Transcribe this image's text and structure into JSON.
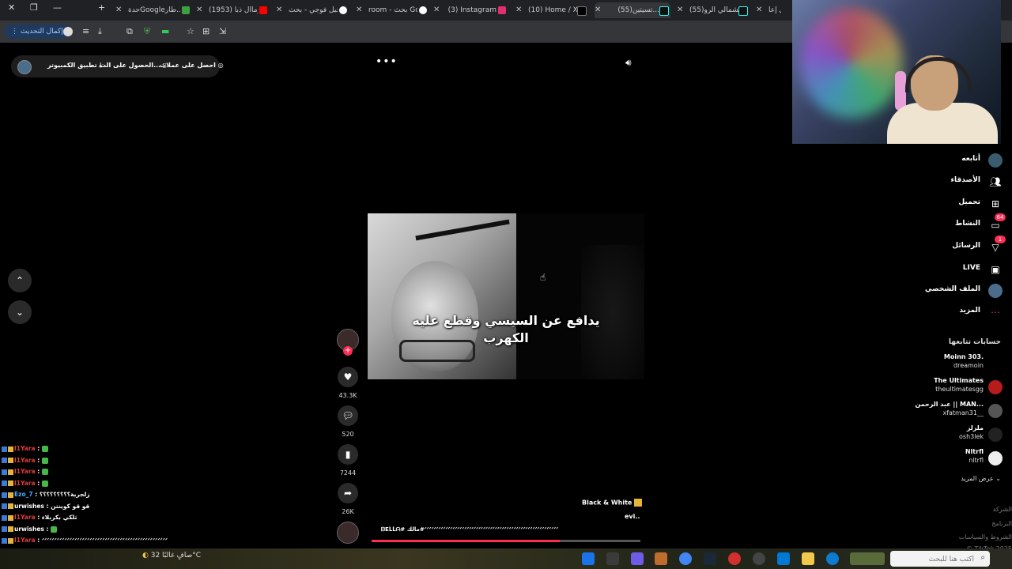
{
  "browser": {
    "tabs": [
      {
        "label": "حدةGoogleطار..."
      },
      {
        "label": "(1953) روماال ذبا..."
      },
      {
        "label": "جبل فوجي - بحث"
      },
      {
        "label": "room - بحث Goo"
      },
      {
        "label": "(3) Instagram"
      },
      {
        "label": "(10) Home / X"
      },
      {
        "label": "(55)تسيتين..."
      },
      {
        "label": "(55)الشمالي الرو..."
      },
      {
        "label": "ماصل إعا..."
      }
    ],
    "update_button": "إكمال التحديث"
  },
  "tiktok": {
    "top_bar": {
      "get_coins": "احصل على عملات",
      "get_app": "الحصول على الت...",
      "desktop_app": "تطبيق الكمبيوتر"
    },
    "video": {
      "caption_line1": "يدافع عن السيسي وقطع عليه",
      "caption_line2": "الكهرب",
      "music_label": "Black & White",
      "description": "evi..",
      "hashtags": "ᗷEᒪᒪᗩ# ﻣﺎﻟﻚ#ᐟᐟᐟᐟᐟᐟᐟᐟᐟᐟᐟᐟᐟᐟᐟᐟᐟᐟᐟᐟᐟᐟᐟᐟᐟᐟᐟᐟᐟᐟᐟᐟᐟᐟᐟᐟᐟᐟᐟᐟᐟᐟᐟᐟᐟᐟᐟᐟᐟᐟᐟᐟᐟᐟᐟᐟᐟ",
      "progress": 0.7
    },
    "actions": {
      "likes": "43.3K",
      "comments": "520",
      "saves": "7244",
      "shares": "26K"
    },
    "sidebar": {
      "items": [
        {
          "label": "أتابعه",
          "icon": "following-icon"
        },
        {
          "label": "الأصدقاء",
          "icon": "friends-icon"
        },
        {
          "label": "تحميل",
          "icon": "upload-icon"
        },
        {
          "label": "النشاط",
          "icon": "activity-icon",
          "badge": "64"
        },
        {
          "label": "الرسائل",
          "icon": "messages-icon",
          "badge": "1"
        },
        {
          "label": "LIVE",
          "icon": "live-icon"
        },
        {
          "label": "الملف الشخصي",
          "icon": "profile-icon"
        },
        {
          "label": "المزيد",
          "icon": "more-icon"
        }
      ],
      "following_title": "حسابات تتابعها",
      "accounts": [
        {
          "name": "Moinn 303.",
          "handle": "dreamoin"
        },
        {
          "name": "The Ultimates",
          "handle": "theultimatesgg"
        },
        {
          "name": "عبد الرحمن || MAN...",
          "handle": "xfatman31__"
        },
        {
          "name": "ملزلز",
          "handle": "osh3lek"
        },
        {
          "name": "Nltrfl",
          "handle": "nltrfl"
        }
      ],
      "see_more": "عرض المزيد",
      "footer": [
        "الشركة",
        "البرنامج",
        "الشروط والسياسات",
        "TikTok 2025 ©"
      ]
    }
  },
  "stream_chat": [
    {
      "user": "I1Yara",
      "msg": "",
      "color": "red"
    },
    {
      "user": "I1Yara",
      "msg": "",
      "color": "red"
    },
    {
      "user": "I1Yara",
      "msg": "",
      "color": "red"
    },
    {
      "user": "I1Yara",
      "msg": "",
      "color": "red"
    },
    {
      "user": "Ezo_7",
      "msg": "زلجرية؟؟؟؟؟؟؟؟؟",
      "color": "blue"
    },
    {
      "user": "urwishes",
      "msg": "قو قو كوينتن",
      "color": "white"
    },
    {
      "user": "I1Yara",
      "msg": "ثلكي بكربلاء",
      "color": "red"
    },
    {
      "user": "urwishes",
      "msg": "",
      "color": "white"
    },
    {
      "user": "I1Yara",
      "msg": "ᐟᐟᐟᐟᐟᐟᐟᐟᐟᐟᐟᐟᐟᐟᐟᐟᐟᐟᐟᐟᐟᐟᐟᐟᐟᐟᐟᐟᐟᐟᐟᐟᐟᐟᐟᐟᐟᐟᐟᐟᐟᐟᐟᐟᐟᐟᐟᐟᐟᐟ",
      "color": "red"
    },
    {
      "user": "",
      "msg": "ᐟᐟᐟᐟᐟᐟᐟᐟᐟᐟᐟᐟᐟᐟᐟᐟᐟᐟᐟᐟᐟᐟᐟᐟᐟᐟᐟᐟᐟᐟᐟᐟᐟᐟᐟᐟᐟᐟᐟᐟᐟᐟᐟᐟᐟᐟᐟᐟᐟᐟᐟᐟᐟᐟᐟᐟᐟᐟᐟᐟ",
      "color": "white"
    },
    {
      "user": "urwishes",
      "msg": "ᐟᐟᐟᐟᐟᐟᐟᐟᐟᐟᐟᐟᐟᐟᐟᐟᐟᐟᐟᐟᐟᐟᐟᐟᐟᐟᐟᐟᐟᐟᐟᐟᐟᐟᐟᐟᐟᐟᐟᐟᐟᐟᐟᐟᐟᐟᐟ",
      "color": "white"
    }
  ],
  "taskbar": {
    "weather": "صافٍ غالبًا 32°C",
    "search_placeholder": "اكتب هنا للبحث"
  }
}
